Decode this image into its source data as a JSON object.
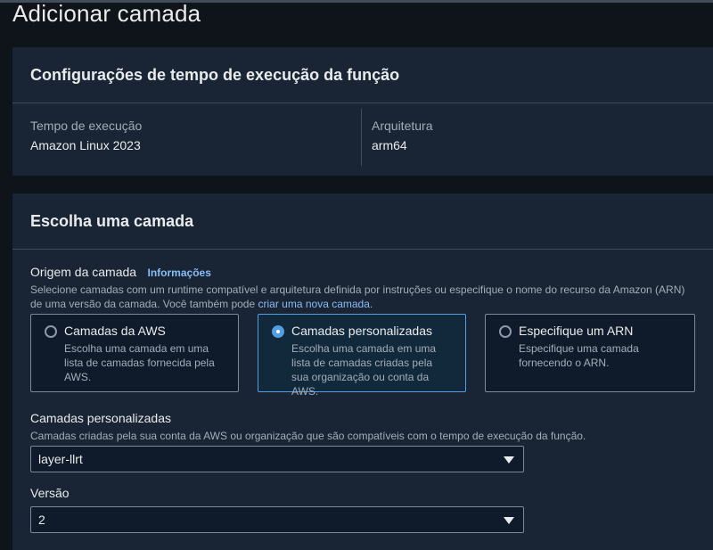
{
  "page": {
    "title": "Adicionar camada"
  },
  "runtime_card": {
    "title": "Configurações de tempo de execução da função",
    "runtime_label": "Tempo de execução",
    "runtime_value": "Amazon Linux 2023",
    "arch_label": "Arquitetura",
    "arch_value": "arm64"
  },
  "layer_card": {
    "title": "Escolha uma camada",
    "source_label": "Origem da camada",
    "info_link": "Informações",
    "source_desc_line1": "Selecione camadas com um runtime compatível e arquitetura definida por instruções ou especifique o nome do recurso da Amazon (ARN)",
    "source_desc_line2_prefix": "de uma versão da camada. Você também pode ",
    "create_link": "criar uma nova camada",
    "source_desc_line2_suffix": ".",
    "options": [
      {
        "title": "Camadas da AWS",
        "desc": "Escolha uma camada em uma lista de camadas fornecida pela AWS.",
        "selected": false
      },
      {
        "title": "Camadas personalizadas",
        "desc": "Escolha uma camada em uma lista de camadas criadas pela sua organização ou conta da AWS.",
        "selected": true
      },
      {
        "title": "Especifique um ARN",
        "desc": "Especifique uma camada fornecendo o ARN.",
        "selected": false
      }
    ],
    "custom_layers_label": "Camadas personalizadas",
    "custom_layers_desc": "Camadas criadas pela sua conta da AWS ou organização que são compatíveis com o tempo de execução da função.",
    "custom_layers_value": "layer-llrt",
    "version_label": "Versão",
    "version_value": "2"
  },
  "colors": {
    "background": "#0f141a",
    "card": "#192534",
    "accent": "#539fe5",
    "link": "#89bdf6"
  }
}
